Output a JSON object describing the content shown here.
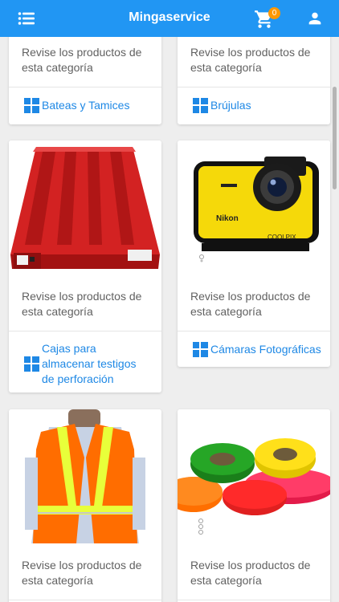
{
  "header": {
    "title": "Mingaservice",
    "cart_count": "0"
  },
  "icons": {
    "menu": "list-menu-icon",
    "cart": "shopping-cart-icon",
    "user": "user-icon",
    "category": "grid-icon",
    "pager": "pager-dots-icon"
  },
  "colors": {
    "primary": "#2196f3",
    "badge": "#ff9800",
    "link": "#1e88e5"
  },
  "cards": [
    {
      "description": "Revise los productos de esta categoría",
      "category": "Bateas y Tamices"
    },
    {
      "description": "Revise los productos de esta categoría",
      "category": "Brújulas"
    },
    {
      "description": "Revise los productos de esta categoría",
      "category": "Cajas para almacenar testigos de perforación"
    },
    {
      "description": "Revise los productos de esta categoría",
      "category": "Cámaras Fotográficas"
    },
    {
      "description": "Revise los productos de esta categoría"
    },
    {
      "description": "Revise los productos de esta categoría"
    }
  ],
  "camera_brand": "Nikon",
  "camera_model": "COOLPIX"
}
